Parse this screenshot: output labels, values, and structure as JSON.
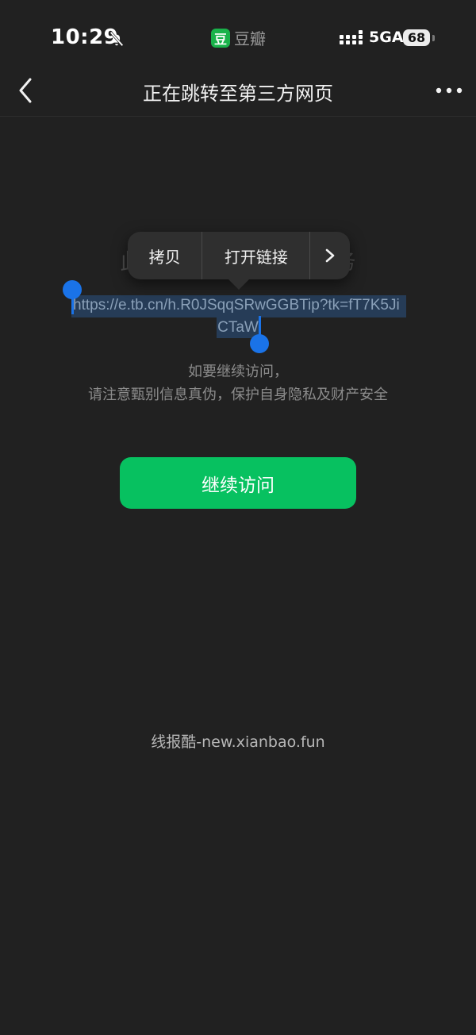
{
  "status_bar": {
    "time": "10:29",
    "app_logo_char": "豆",
    "app_name": "豆瓣",
    "network": "5GA",
    "battery": "68"
  },
  "nav": {
    "title": "正在跳转至第三方网页"
  },
  "main": {
    "headline": "此网页由第三方提供服务",
    "url_line1": "https://e.tb.cn/h.R0JSqqSRwGGBTip?tk=fT7K5Ji",
    "url_line2": "CTaW",
    "notice_line1": "如要继续访问，",
    "notice_line2": "请注意甄别信息真伪，保护自身隐私及财产安全",
    "continue_label": "继续访问",
    "footer": "线报酷-new.xianbao.fun"
  },
  "context_menu": {
    "copy": "拷贝",
    "open_link": "打开链接",
    "more": "›"
  },
  "colors": {
    "background": "#212121",
    "accent": "#07c160",
    "selection": "#263c57",
    "handle": "#1a73e8"
  }
}
